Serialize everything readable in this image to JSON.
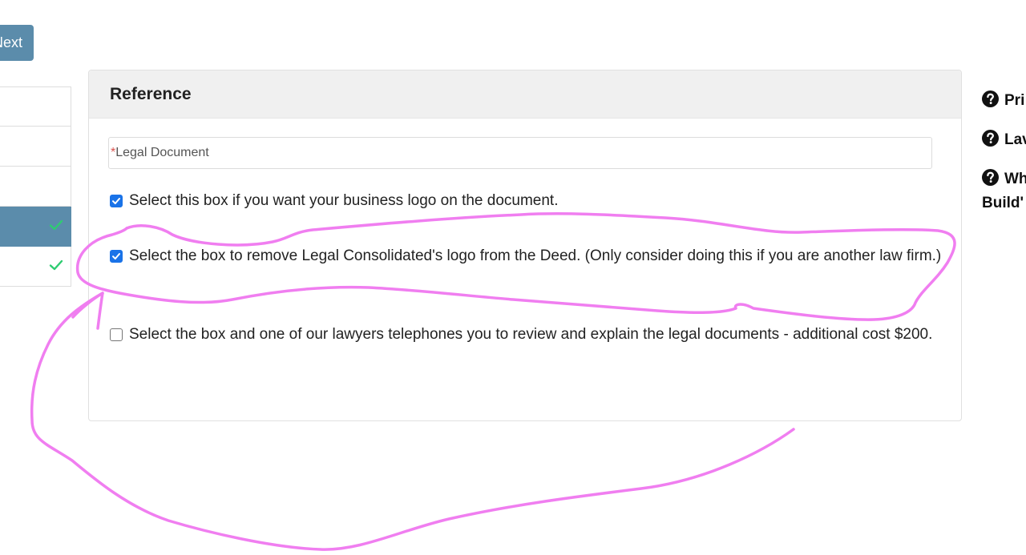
{
  "toolbar": {
    "next_label": "Next"
  },
  "steps": {
    "items": [
      {
        "state": "default",
        "completed": false
      },
      {
        "state": "default",
        "completed": false
      },
      {
        "state": "default",
        "completed": false
      },
      {
        "state": "active",
        "completed": true
      },
      {
        "state": "default",
        "completed": true
      }
    ]
  },
  "card": {
    "title": "Reference",
    "document_field": {
      "required_marker": "*",
      "placeholder": "Legal Document"
    },
    "options": [
      {
        "checked": true,
        "label": "Select this box if you want your business logo on the document."
      },
      {
        "checked": true,
        "label": "Select the box to remove Legal Consolidated's logo from the Deed. (Only consider doing this if you are another law firm.)"
      },
      {
        "checked": false,
        "label": "Select the box and one of our lawyers telephones you to review and explain the legal documents - additional cost $200."
      }
    ]
  },
  "help": {
    "items": [
      {
        "icon": "question-circle-icon",
        "label": "Pri"
      },
      {
        "icon": "question-circle-icon",
        "label": "Lav"
      },
      {
        "icon": "question-circle-icon",
        "label": "Wh",
        "label_line2": "Build'"
      }
    ]
  },
  "colors": {
    "accent": "#5b8cab",
    "checkbox": "#1a73e8",
    "check_mark": "#2ecc71",
    "annotation": "#f07ef0",
    "required": "#d9534f"
  },
  "annotation": {
    "color": "#f07ef0",
    "shape": "hand-drawn-circle-and-arrow"
  }
}
